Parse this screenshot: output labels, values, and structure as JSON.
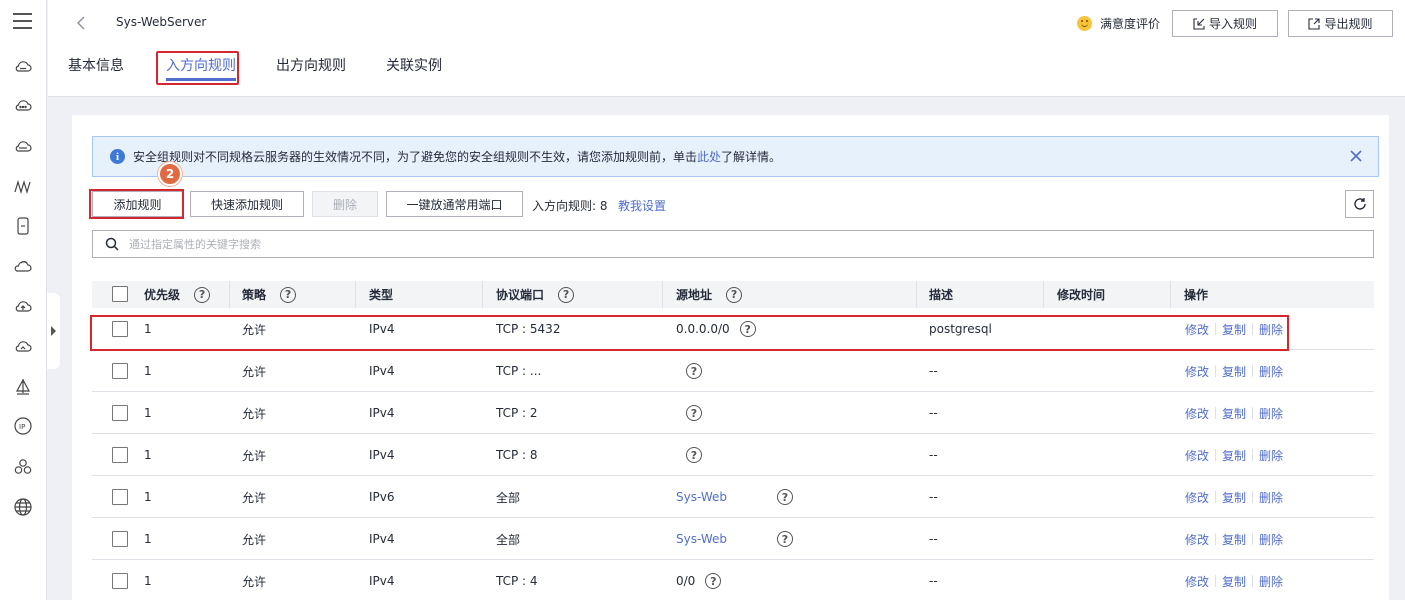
{
  "header": {
    "title": "Sys-WebServer",
    "satisfaction": "满意度评价",
    "import_label": "导入规则",
    "export_label": "导出规则"
  },
  "tabs": [
    {
      "label": "基本信息"
    },
    {
      "label": "入方向规则"
    },
    {
      "label": "出方向规则"
    },
    {
      "label": "关联实例"
    }
  ],
  "notice": {
    "text_before": "安全组规则对不同规格云服务器的生效情况不同，为了避免您的安全组规则不生效，请您添加规则前，单击",
    "link": "此处",
    "text_after": "了解详情。"
  },
  "step_badge": "2",
  "toolbar": {
    "add": "添加规则",
    "quick_add": "快速添加规则",
    "delete": "删除",
    "one_click": "一键放通常用端口",
    "rule_count": "入方向规则: 8",
    "help_link": "教我设置"
  },
  "search": {
    "placeholder": "通过指定属性的关键字搜索"
  },
  "table": {
    "headers": [
      "优先级",
      "策略",
      "类型",
      "协议端口",
      "源地址",
      "描述",
      "修改时间",
      "操作"
    ],
    "rows": [
      {
        "priority": "1",
        "policy": "允许",
        "type": "IPv4",
        "port": "TCP : 5432",
        "source": "0.0.0.0/0",
        "desc": "postgresql",
        "time": "",
        "source_link": false
      },
      {
        "priority": "1",
        "policy": "允许",
        "type": "IPv4",
        "port": "TCP : ...",
        "source": "",
        "desc": "--",
        "time": "",
        "source_link": false
      },
      {
        "priority": "1",
        "policy": "允许",
        "type": "IPv4",
        "port": "TCP : 2",
        "source": "",
        "desc": "--",
        "time": "",
        "source_link": false
      },
      {
        "priority": "1",
        "policy": "允许",
        "type": "IPv4",
        "port": "TCP : 8",
        "source": "",
        "desc": "--",
        "time": "",
        "source_link": false
      },
      {
        "priority": "1",
        "policy": "允许",
        "type": "IPv6",
        "port": "全部",
        "source": "Sys-Web",
        "desc": "--",
        "time": "",
        "source_link": true
      },
      {
        "priority": "1",
        "policy": "允许",
        "type": "IPv4",
        "port": "全部",
        "source": "Sys-Web",
        "desc": "--",
        "time": "",
        "source_link": true
      },
      {
        "priority": "1",
        "policy": "允许",
        "type": "IPv4",
        "port": "TCP : 4",
        "source": "0/0",
        "desc": "--",
        "time": "",
        "source_link": false
      }
    ],
    "ops": {
      "modify": "修改",
      "copy": "复制",
      "delete": "删除"
    }
  },
  "colors": {
    "accent": "#526ecc",
    "highlight": "#d4272f",
    "badge": "#e06b43"
  },
  "sidebar_icons": [
    "cloud-icon",
    "cloud-dots-icon",
    "cloud-server-icon",
    "network-wave-icon",
    "database-icon",
    "cloud-cycle-icon",
    "cloud-upload-icon",
    "cloud-sync-icon",
    "sail-icon",
    "ip-icon",
    "cluster-icon",
    "globe-icon"
  ]
}
